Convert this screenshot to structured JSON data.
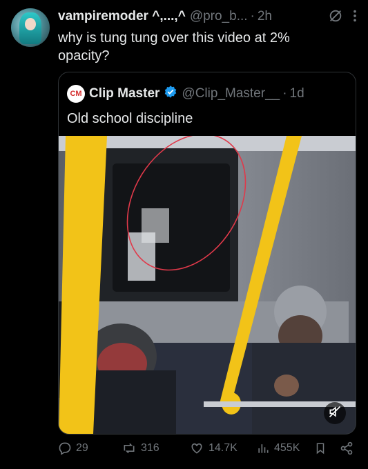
{
  "post": {
    "display_name": "vampiremoder ^,...,^",
    "handle": "@pro_b...",
    "separator": "·",
    "time": "2h",
    "text": "why is tung tung over this video at 2% opacity?"
  },
  "quoted": {
    "logo_text": "CM",
    "display_name": "Clip Master",
    "handle": "@Clip_Master__",
    "separator": "·",
    "time": "1d",
    "text": "Old school discipline",
    "verified": true
  },
  "actions": {
    "replies": "29",
    "reposts": "316",
    "likes": "14.7K",
    "views": "455K"
  },
  "icons": [
    "grok-icon",
    "more-icon",
    "verified-icon",
    "mute-icon",
    "reply-icon",
    "repost-icon",
    "like-icon",
    "views-icon",
    "bookmark-icon",
    "share-icon"
  ],
  "colors": {
    "background": "#000000",
    "text": "#e7e9ea",
    "muted": "#71767b",
    "verified": "#1d9bf0",
    "border": "#2f3336",
    "pole": "#f2c318"
  }
}
